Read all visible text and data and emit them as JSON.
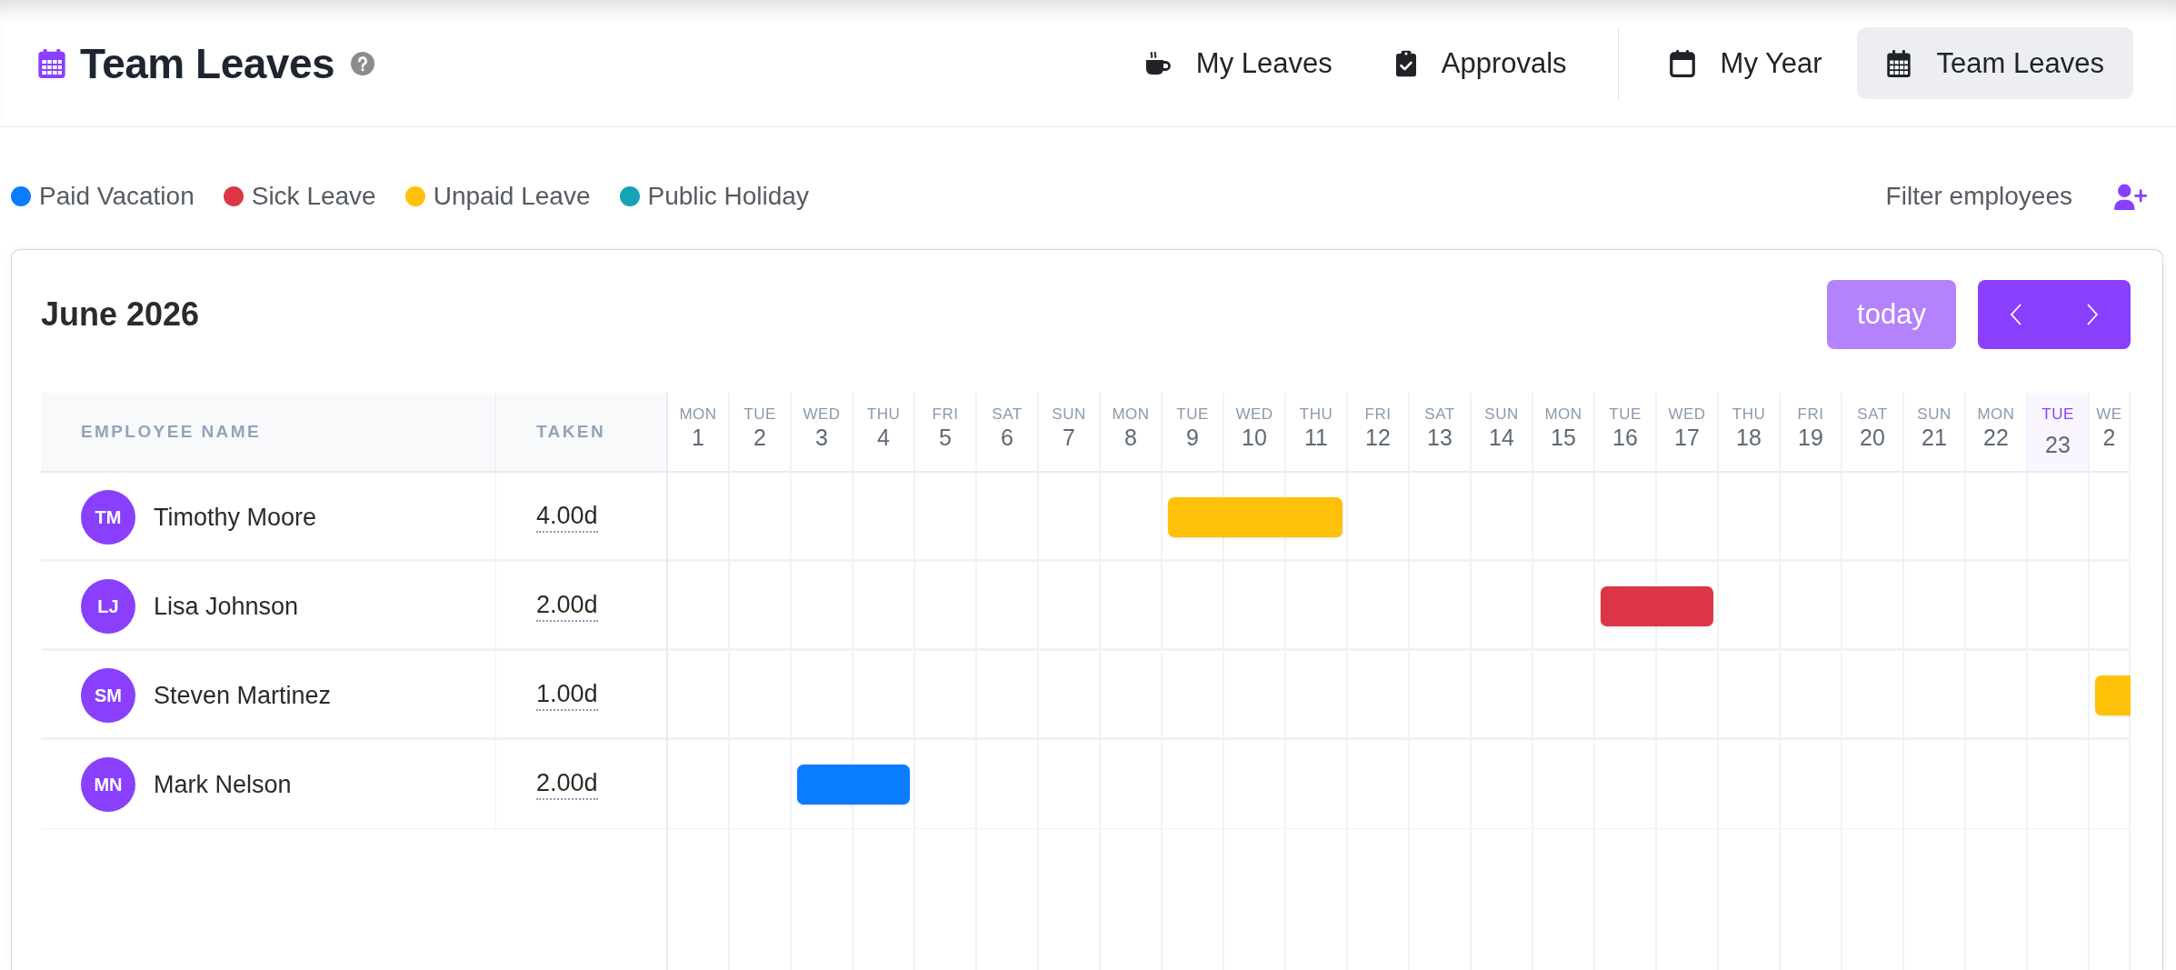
{
  "header": {
    "title": "Team Leaves",
    "nav_groups": [
      [
        {
          "label": "My Leaves",
          "selected": false
        },
        {
          "label": "Approvals",
          "selected": false
        }
      ],
      [
        {
          "label": "My Year",
          "selected": false
        },
        {
          "label": "Team Leaves",
          "selected": true
        }
      ]
    ]
  },
  "legend": [
    {
      "label": "Paid Vacation",
      "color": "#0a7cff"
    },
    {
      "label": "Sick Leave",
      "color": "#dc3545"
    },
    {
      "label": "Unpaid Leave",
      "color": "#ffc107"
    },
    {
      "label": "Public Holiday",
      "color": "#17a2b8"
    }
  ],
  "filter": {
    "label": "Filter employees"
  },
  "calendar": {
    "title": "June 2026",
    "today_button": {
      "label": "today",
      "disabled": true
    },
    "columns": {
      "name": "EMPLOYEE NAME",
      "taken": "TAKEN"
    },
    "days": [
      {
        "dow": "MON",
        "num": "1",
        "today": false
      },
      {
        "dow": "TUE",
        "num": "2",
        "today": false
      },
      {
        "dow": "WED",
        "num": "3",
        "today": false
      },
      {
        "dow": "THU",
        "num": "4",
        "today": false
      },
      {
        "dow": "FRI",
        "num": "5",
        "today": false
      },
      {
        "dow": "SAT",
        "num": "6",
        "today": false
      },
      {
        "dow": "SUN",
        "num": "7",
        "today": false
      },
      {
        "dow": "MON",
        "num": "8",
        "today": false
      },
      {
        "dow": "TUE",
        "num": "9",
        "today": false
      },
      {
        "dow": "WED",
        "num": "10",
        "today": false
      },
      {
        "dow": "THU",
        "num": "11",
        "today": false
      },
      {
        "dow": "FRI",
        "num": "12",
        "today": false
      },
      {
        "dow": "SAT",
        "num": "13",
        "today": false
      },
      {
        "dow": "SUN",
        "num": "14",
        "today": false
      },
      {
        "dow": "MON",
        "num": "15",
        "today": false
      },
      {
        "dow": "TUE",
        "num": "16",
        "today": false
      },
      {
        "dow": "WED",
        "num": "17",
        "today": false
      },
      {
        "dow": "THU",
        "num": "18",
        "today": false
      },
      {
        "dow": "FRI",
        "num": "19",
        "today": false
      },
      {
        "dow": "SAT",
        "num": "20",
        "today": false
      },
      {
        "dow": "SUN",
        "num": "21",
        "today": false
      },
      {
        "dow": "MON",
        "num": "22",
        "today": false
      },
      {
        "dow": "TUE",
        "num": "23",
        "today": true
      },
      {
        "dow": "WE",
        "num": "2",
        "today": false
      }
    ],
    "rows": [
      {
        "initials": "TM",
        "name": "Timothy Moore",
        "taken": "4.00d",
        "days": [
          {
            "leave": false
          },
          {
            "leave": false
          },
          {
            "leave": false
          },
          {
            "leave": false
          },
          {
            "leave": false
          },
          {
            "leave": false
          },
          {
            "leave": false
          },
          {
            "leave": false
          },
          {
            "leave": true,
            "color": "#ffc107"
          },
          {
            "leave": true,
            "color": "#ffc107"
          },
          {
            "leave": true,
            "color": "#ffc107"
          },
          {
            "leave": false
          },
          {
            "leave": false
          },
          {
            "leave": false
          },
          {
            "leave": false
          },
          {
            "leave": false
          },
          {
            "leave": false
          },
          {
            "leave": false
          },
          {
            "leave": false
          },
          {
            "leave": false
          },
          {
            "leave": false
          },
          {
            "leave": false
          },
          {
            "leave": false
          },
          {
            "leave": false
          }
        ]
      },
      {
        "initials": "LJ",
        "name": "Lisa Johnson",
        "taken": "2.00d",
        "days": [
          {
            "leave": false
          },
          {
            "leave": false
          },
          {
            "leave": false
          },
          {
            "leave": false
          },
          {
            "leave": false
          },
          {
            "leave": false
          },
          {
            "leave": false
          },
          {
            "leave": false
          },
          {
            "leave": false
          },
          {
            "leave": false
          },
          {
            "leave": false
          },
          {
            "leave": false
          },
          {
            "leave": false
          },
          {
            "leave": false
          },
          {
            "leave": false
          },
          {
            "leave": true,
            "color": "#dc3545"
          },
          {
            "leave": true,
            "color": "#dc3545"
          },
          {
            "leave": false
          },
          {
            "leave": false
          },
          {
            "leave": false
          },
          {
            "leave": false
          },
          {
            "leave": false
          },
          {
            "leave": false
          },
          {
            "leave": false
          }
        ]
      },
      {
        "initials": "SM",
        "name": "Steven Martinez",
        "taken": "1.00d",
        "days": [
          {
            "leave": false
          },
          {
            "leave": false
          },
          {
            "leave": false
          },
          {
            "leave": false
          },
          {
            "leave": false
          },
          {
            "leave": false
          },
          {
            "leave": false
          },
          {
            "leave": false
          },
          {
            "leave": false
          },
          {
            "leave": false
          },
          {
            "leave": false
          },
          {
            "leave": false
          },
          {
            "leave": false
          },
          {
            "leave": false
          },
          {
            "leave": false
          },
          {
            "leave": false
          },
          {
            "leave": false
          },
          {
            "leave": false
          },
          {
            "leave": false
          },
          {
            "leave": false
          },
          {
            "leave": false
          },
          {
            "leave": false
          },
          {
            "leave": false
          },
          {
            "leave": true,
            "color": "#ffc107"
          }
        ]
      },
      {
        "initials": "MN",
        "name": "Mark Nelson",
        "taken": "2.00d",
        "days": [
          {
            "leave": false
          },
          {
            "leave": false
          },
          {
            "leave": true,
            "color": "#0a7cff"
          },
          {
            "leave": true,
            "color": "#0a7cff"
          },
          {
            "leave": false
          },
          {
            "leave": false
          },
          {
            "leave": false
          },
          {
            "leave": false
          },
          {
            "leave": false
          },
          {
            "leave": false
          },
          {
            "leave": false
          },
          {
            "leave": false
          },
          {
            "leave": false
          },
          {
            "leave": false
          },
          {
            "leave": false
          },
          {
            "leave": false
          },
          {
            "leave": false
          },
          {
            "leave": false
          },
          {
            "leave": false
          },
          {
            "leave": false
          },
          {
            "leave": false
          },
          {
            "leave": false
          },
          {
            "leave": false
          },
          {
            "leave": false
          }
        ]
      }
    ]
  }
}
